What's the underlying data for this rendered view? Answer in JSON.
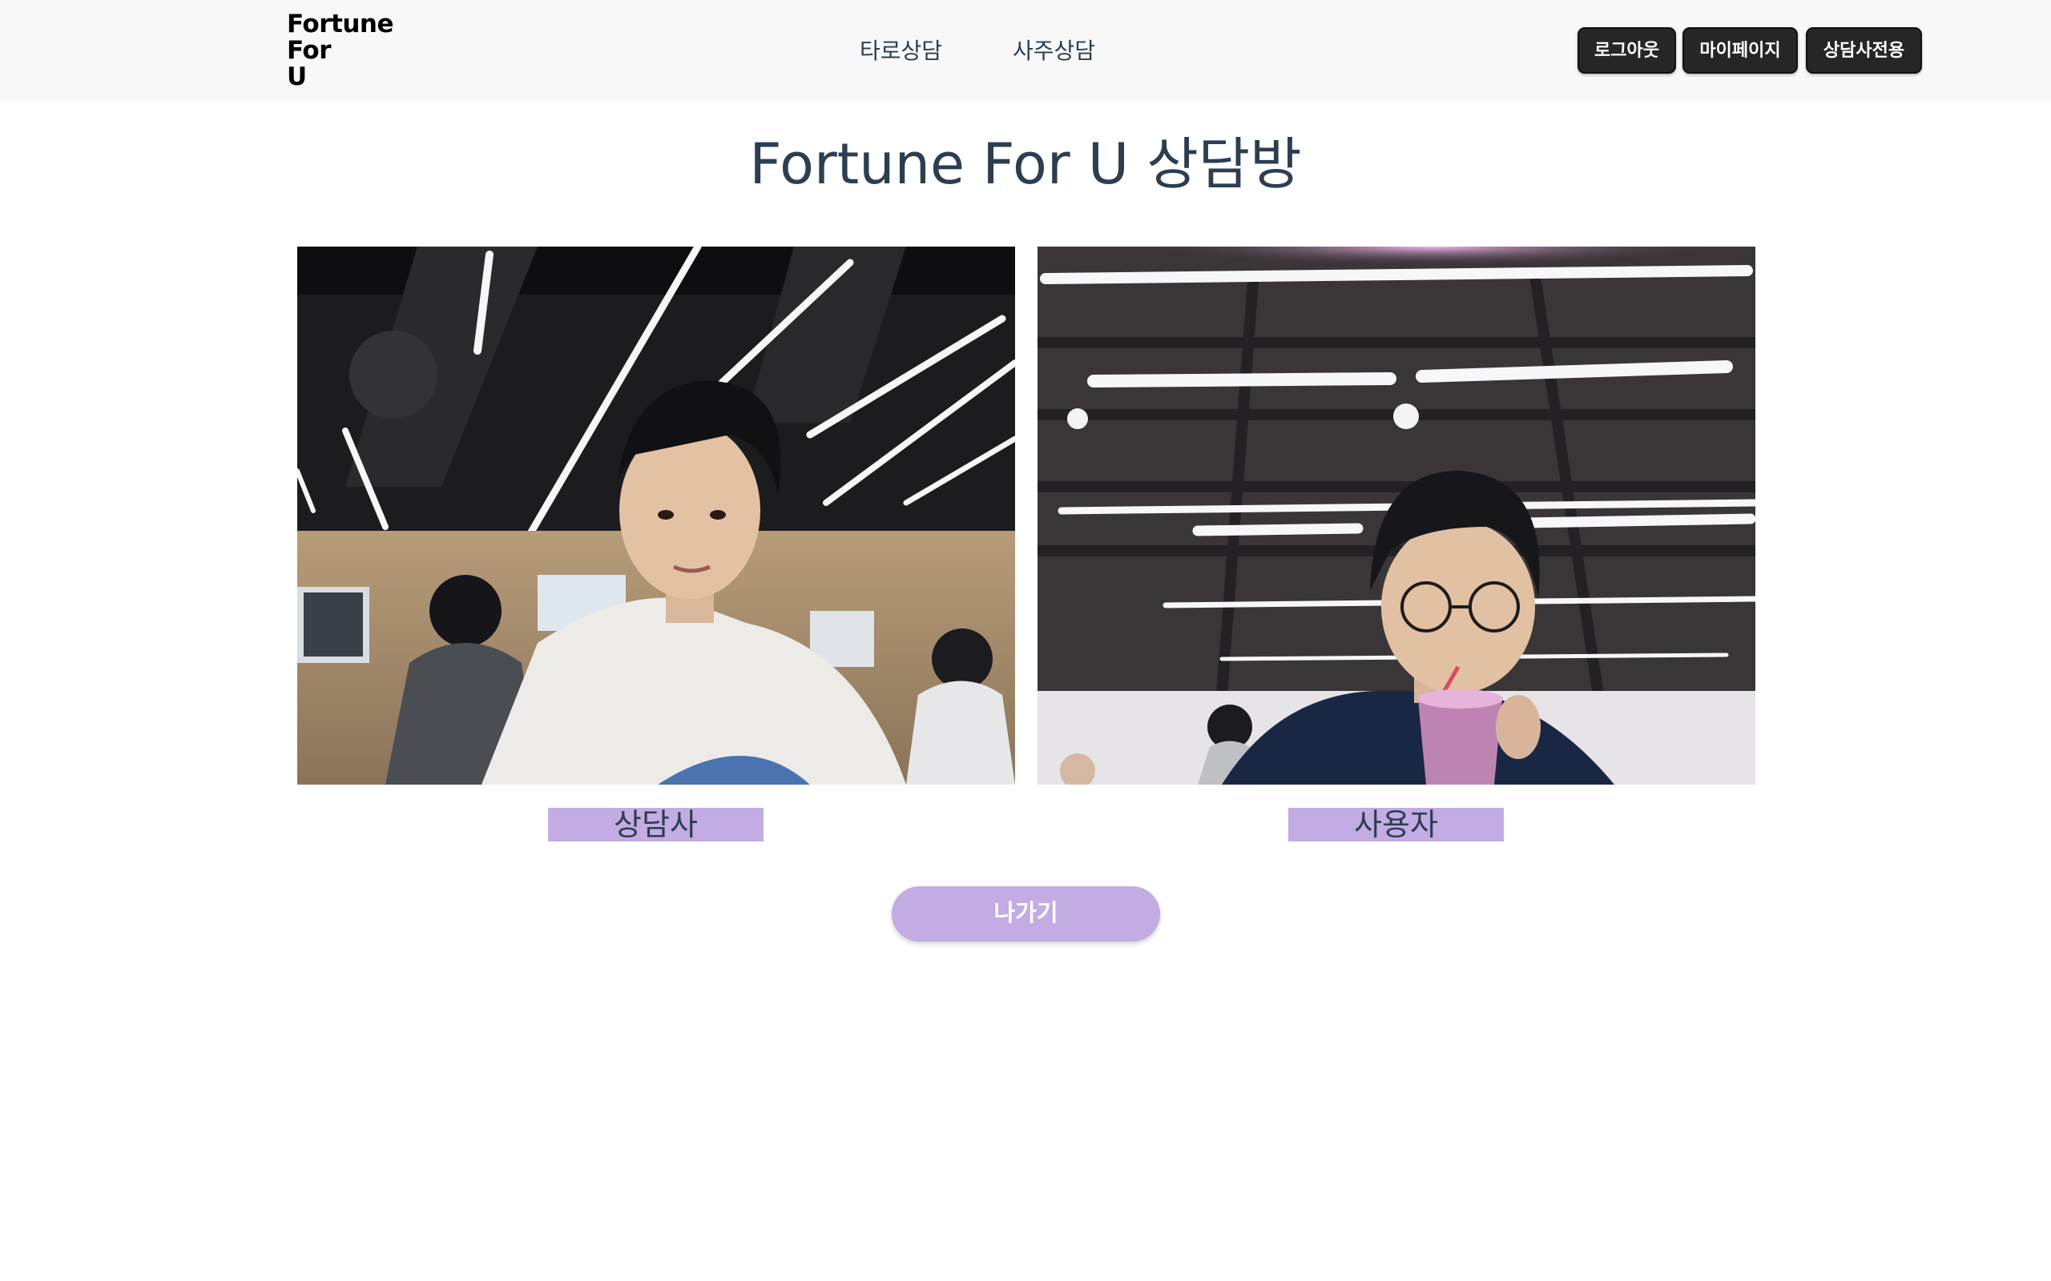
{
  "header": {
    "logo_lines": [
      "Fortune",
      "For",
      "U"
    ],
    "nav": {
      "tarot": "타로상담",
      "saju": "사주상담"
    },
    "buttons": {
      "logout": "로그아웃",
      "mypage": "마이페이지",
      "counselor_only": "상담사전용"
    }
  },
  "main": {
    "title": "Fortune For U 상담방",
    "videos": [
      {
        "label": "상담사",
        "icon": "webcam-feed"
      },
      {
        "label": "사용자",
        "icon": "webcam-feed"
      }
    ],
    "leave_button": "나가기"
  },
  "colors": {
    "header_bg": "#f8f8f8",
    "header_button_bg": "#262626",
    "title_text": "#2c3e50",
    "accent_lavender": "#c2ace3"
  }
}
